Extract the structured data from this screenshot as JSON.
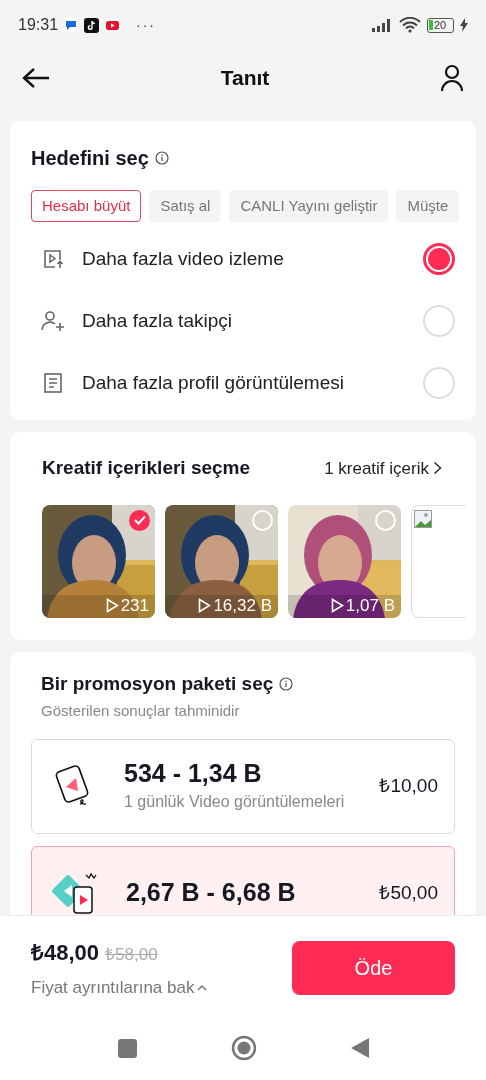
{
  "status_bar": {
    "time": "19:31",
    "more": "···",
    "battery": "20"
  },
  "header": {
    "title": "Tanıt"
  },
  "goal": {
    "title": "Hedefini seç",
    "chips": [
      {
        "label": "Hesabı büyüt",
        "selected": true
      },
      {
        "label": "Satış al",
        "selected": false
      },
      {
        "label": "CANLI Yayını geliştir",
        "selected": false
      },
      {
        "label": "Müşte",
        "selected": false
      }
    ],
    "options": [
      {
        "kind": "video",
        "label": "Daha fazla video izleme",
        "selected": true
      },
      {
        "kind": "follower",
        "label": "Daha fazla takipçi",
        "selected": false
      },
      {
        "kind": "profile",
        "label": "Daha fazla profil görüntülemesi",
        "selected": false
      }
    ]
  },
  "creatives": {
    "title": "Kreatif içerikleri seçme",
    "count_link": "1 kreatif içerik",
    "items": [
      {
        "kind": "video",
        "views": "231",
        "selected": true
      },
      {
        "kind": "video",
        "views": "16,32 B",
        "selected": false
      },
      {
        "kind": "video",
        "views": "1,07 B",
        "selected": false
      },
      {
        "kind": "broken"
      }
    ]
  },
  "packages": {
    "title": "Bir promosyon paketi seç",
    "subtitle": "Gösterilen sonuçlar tahminidir",
    "items": [
      {
        "kind": "single",
        "range": "534 - 1,34 B",
        "detail": "1 günlük Video görüntülemeleri",
        "price": "₺10,00",
        "selected": false
      },
      {
        "kind": "double",
        "range": "2,67 B - 6,68 B",
        "price": "₺50,00",
        "selected": true
      }
    ]
  },
  "footer": {
    "price": "₺48,00",
    "old_price": "₺58,00",
    "details_link": "Fiyat ayrıntılarına bak",
    "pay_button": "Öde"
  }
}
